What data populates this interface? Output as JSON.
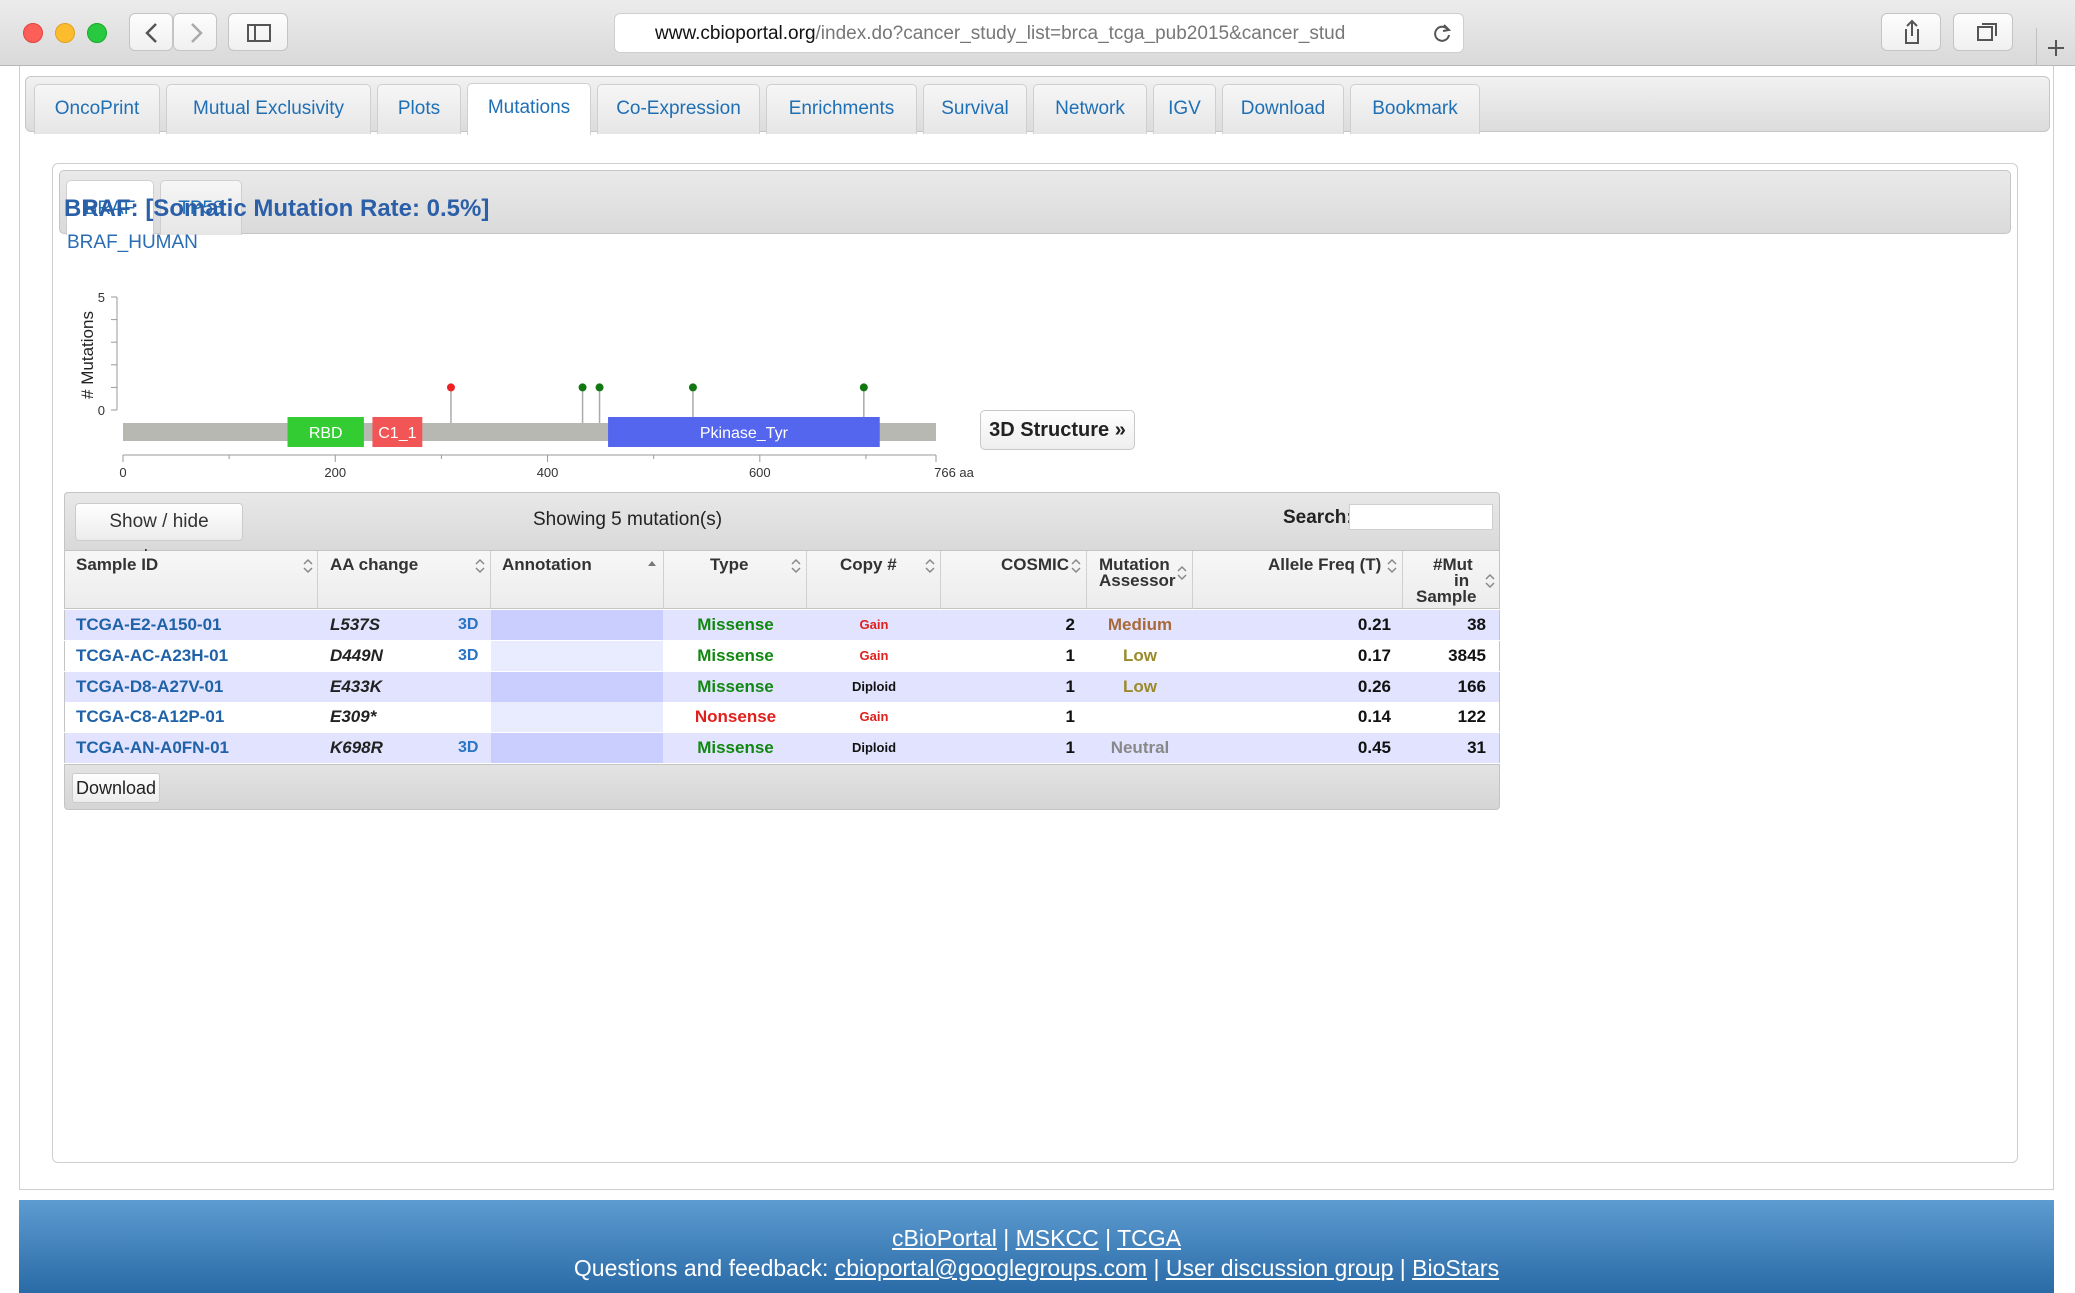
{
  "browser": {
    "url_domain": "www.cbioportal.org",
    "url_path": "/index.do?cancer_study_list=brca_tcga_pub2015&cancer_stud"
  },
  "main_tabs": [
    "OncoPrint",
    "Mutual Exclusivity",
    "Plots",
    "Mutations",
    "Co-Expression",
    "Enrichments",
    "Survival",
    "Network",
    "IGV",
    "Download",
    "Bookmark"
  ],
  "active_main_tab": "Mutations",
  "gene_tabs": [
    "BRAF",
    "TP53"
  ],
  "active_gene_tab": "BRAF",
  "gene_title": "BRAF: [Somatic Mutation Rate: 0.5%]",
  "uniprot_link": "BRAF_HUMAN",
  "structure_button": "3D Structure »",
  "chart_data": {
    "type": "scatter",
    "ylabel": "# Mutations",
    "y_ticks": [
      "5",
      "0"
    ],
    "x_ticks": [
      "0",
      "200",
      "400",
      "600",
      "766 aa"
    ],
    "protein_length": 766,
    "domains": [
      {
        "name": "RBD",
        "start": 155,
        "end": 227,
        "color": "#33cc33"
      },
      {
        "name": "C1_1",
        "start": 235,
        "end": 282,
        "color": "#f25555"
      },
      {
        "name": "Pkinase_Tyr",
        "start": 457,
        "end": 713,
        "color": "#5566ee"
      }
    ],
    "mutations": [
      {
        "position": 309,
        "count": 1,
        "color": "#ee2222"
      },
      {
        "position": 433,
        "count": 1,
        "color": "#117711"
      },
      {
        "position": 449,
        "count": 1,
        "color": "#117711"
      },
      {
        "position": 537,
        "count": 1,
        "color": "#117711"
      },
      {
        "position": 698,
        "count": 1,
        "color": "#117711"
      }
    ]
  },
  "table": {
    "show_hide_label": "Show / hide columns",
    "showing_text": "Showing 5 mutation(s)",
    "search_label": "Search:",
    "search_value": "",
    "download_label": "Download",
    "columns": {
      "sample_id": "Sample ID",
      "aa_change": "AA change",
      "annotation": "Annotation",
      "type": "Type",
      "copy": "Copy #",
      "cosmic": "COSMIC",
      "ma_line1": "Mutation",
      "ma_line2": "Assessor",
      "af": "Allele Freq (T)",
      "mut_line1": "#Mut",
      "mut_line2": "in",
      "mut_line3": "Sample"
    },
    "rows": [
      {
        "sample": "TCGA-E2-A150-01",
        "aa": "L537S",
        "has3d": "3D",
        "type": "Missense",
        "type_color": "#118811",
        "copy": "Gain",
        "copy_color": "#e0201c",
        "cosmic": "2",
        "ma": "Medium",
        "ma_color": "#a86a3a",
        "af": "0.21",
        "mut": "38"
      },
      {
        "sample": "TCGA-AC-A23H-01",
        "aa": "D449N",
        "has3d": "3D",
        "type": "Missense",
        "type_color": "#118811",
        "copy": "Gain",
        "copy_color": "#e0201c",
        "cosmic": "1",
        "ma": "Low",
        "ma_color": "#9a8a2a",
        "af": "0.17",
        "mut": "3845"
      },
      {
        "sample": "TCGA-D8-A27V-01",
        "aa": "E433K",
        "has3d": "",
        "type": "Missense",
        "type_color": "#118811",
        "copy": "Diploid",
        "copy_color": "#111111",
        "cosmic": "1",
        "ma": "Low",
        "ma_color": "#9a8a2a",
        "af": "0.26",
        "mut": "166"
      },
      {
        "sample": "TCGA-C8-A12P-01",
        "aa": "E309*",
        "has3d": "",
        "type": "Nonsense",
        "type_color": "#e0201c",
        "copy": "Gain",
        "copy_color": "#e0201c",
        "cosmic": "1",
        "ma": "",
        "ma_color": "#9a8a2a",
        "af": "0.14",
        "mut": "122"
      },
      {
        "sample": "TCGA-AN-A0FN-01",
        "aa": "K698R",
        "has3d": "3D",
        "type": "Missense",
        "type_color": "#118811",
        "copy": "Diploid",
        "copy_color": "#111111",
        "cosmic": "1",
        "ma": "Neutral",
        "ma_color": "#888888",
        "af": "0.45",
        "mut": "31"
      }
    ]
  },
  "footer": {
    "link1": "cBioPortal",
    "link2": "MSKCC",
    "link3": "TCGA",
    "sep": "|",
    "feedback_label": "Questions and feedback:",
    "email": "cbioportal@googlegroups.com",
    "discussion": "User discussion group",
    "biostars": "BioStars"
  }
}
